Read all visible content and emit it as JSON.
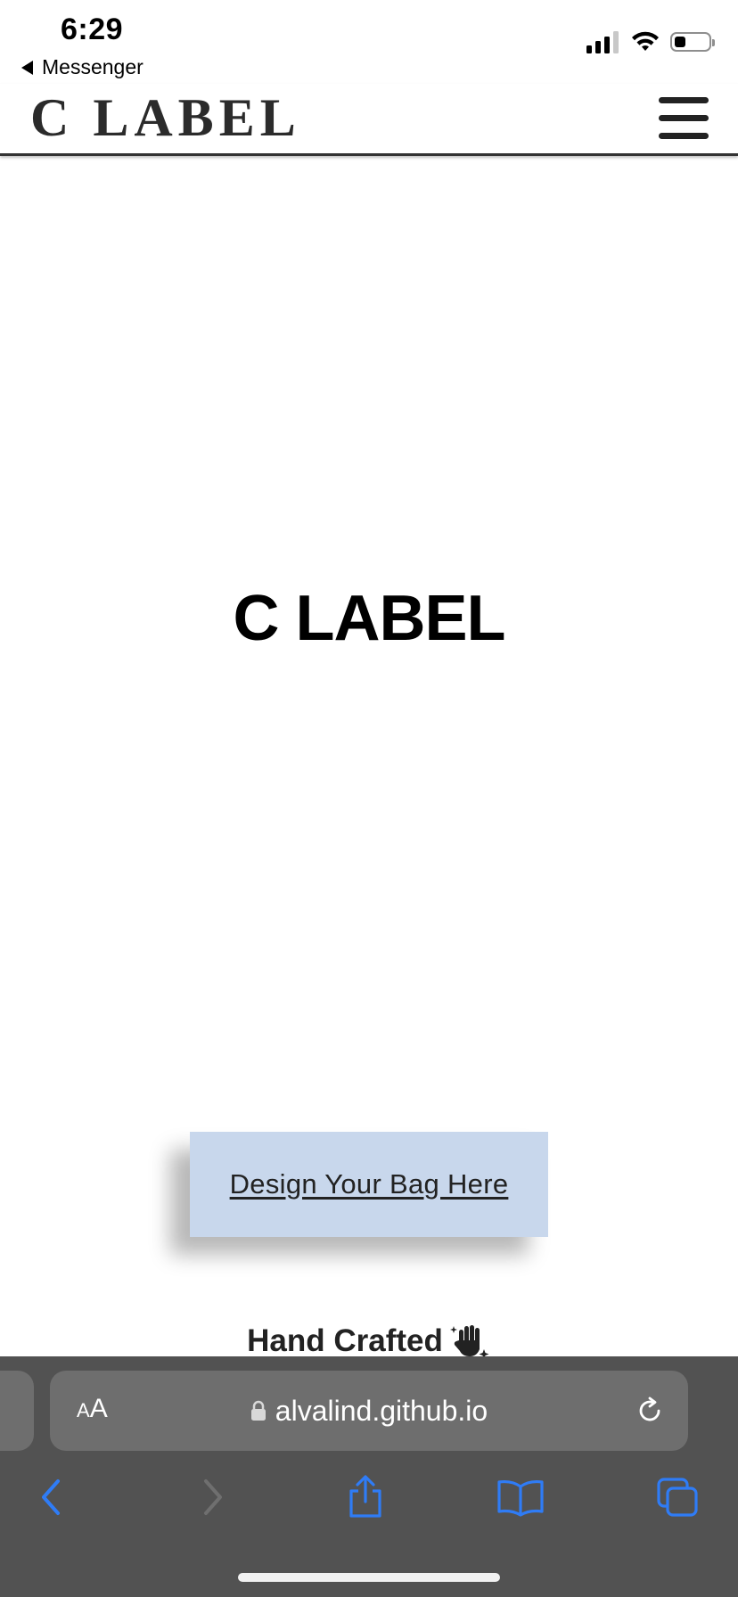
{
  "status_bar": {
    "time": "6:29",
    "back_app": "Messenger"
  },
  "site": {
    "logo": "C LABEL",
    "hero_title": "C LABEL",
    "design_button": "Design Your Bag Here",
    "hand_crafted": "Hand Crafted"
  },
  "browser": {
    "aa_small": "A",
    "aa_large": "A",
    "url": "alvalind.github.io"
  },
  "colors": {
    "button_bg": "#c8d7ec",
    "toolbar_bg": "#525252",
    "url_bar_bg": "#6e6e6e",
    "ios_blue": "#2f7cf6"
  },
  "icons": {
    "menu": "hamburger-icon",
    "back": "chevron-left-icon",
    "forward": "chevron-right-icon",
    "share": "share-icon",
    "bookmarks": "book-icon",
    "tabs": "tabs-icon",
    "hand": "hand-sparkles-icon"
  }
}
